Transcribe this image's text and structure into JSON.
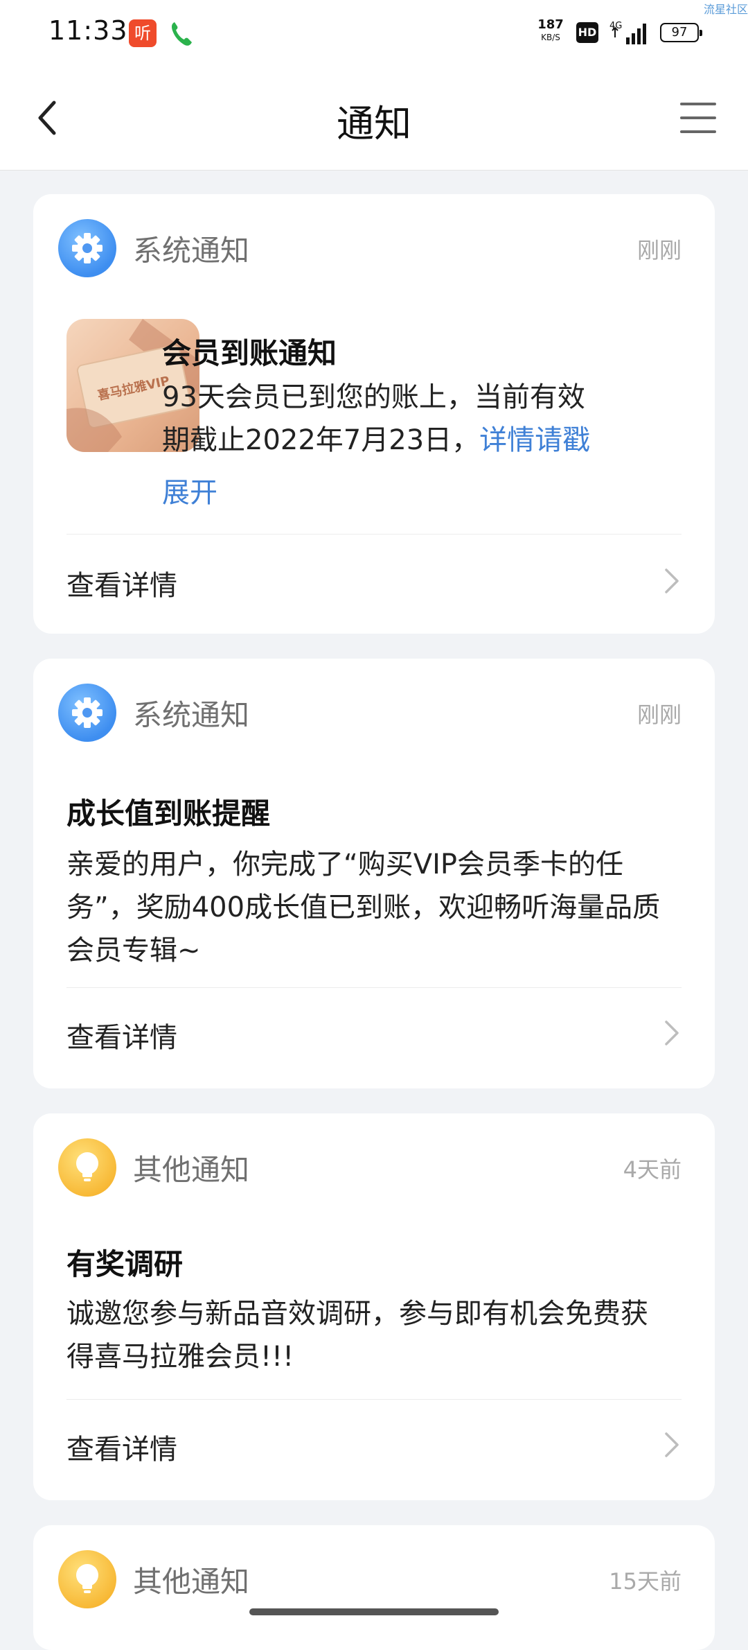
{
  "status_bar": {
    "time": "11:33",
    "app_badge": "听",
    "speed_value": "187",
    "speed_unit": "KB/S",
    "hd": "HD",
    "network": "4G",
    "battery": "97",
    "watermark": "流星社区"
  },
  "header": {
    "title": "通知",
    "back_icon": "back-icon",
    "menu_icon": "menu-icon"
  },
  "notifications": [
    {
      "type_label": "系统通知",
      "type_icon": "gear-icon",
      "time": "刚刚",
      "title": "会员到账通知",
      "thumbnail_text": "喜马拉雅VIP",
      "body_line1": "93天会员已到您的账上，当前有效",
      "body_line2_text": "期截止2022年7月23日，",
      "body_link_part1": "详情请戳",
      "body_link_part2": "展开",
      "detail_label": "查看详情"
    },
    {
      "type_label": "系统通知",
      "type_icon": "gear-icon",
      "time": "刚刚",
      "title": "成长值到账提醒",
      "body_lines": [
        "亲爱的用户，你完成了“购买VIP会员季卡的任",
        "务”，奖励400成长值已到账，欢迎畅听海量品质",
        "会员专辑~"
      ],
      "detail_label": "查看详情"
    },
    {
      "type_label": "其他通知",
      "type_icon": "lightbulb-icon",
      "time": "4天前",
      "title": "有奖调研",
      "body_lines": [
        "诚邀您参与新品音效调研，参与即有机会免费获",
        "得喜马拉雅会员!!!"
      ],
      "detail_label": "查看详情"
    },
    {
      "type_label": "其他通知",
      "type_icon": "lightbulb-icon",
      "time": "15天前"
    }
  ],
  "colors": {
    "background": "#f1f3f6",
    "link": "#3f80d6",
    "system_icon": "#3e8ef0",
    "other_icon": "#f7b733"
  }
}
